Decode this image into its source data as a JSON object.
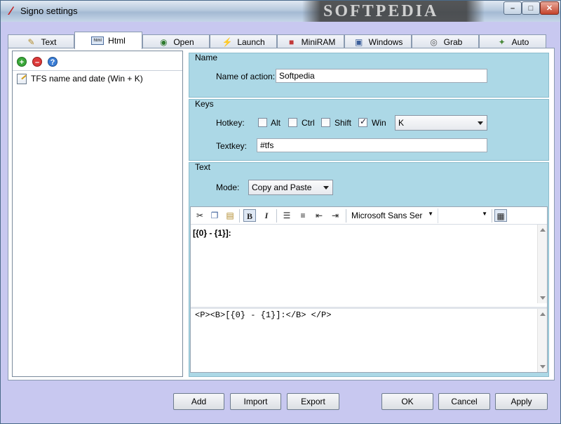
{
  "window": {
    "title": "Signo settings",
    "watermark": "SOFTPEDIA",
    "controls": {
      "minimize": "–",
      "maximize": "□",
      "close": "✕"
    }
  },
  "tabs": [
    {
      "label": "Text",
      "icon": "pencil-icon",
      "active": false
    },
    {
      "label": "Html",
      "icon": "html-icon",
      "active": true
    },
    {
      "label": "Open",
      "icon": "globe-icon",
      "active": false
    },
    {
      "label": "Launch",
      "icon": "lightning-icon",
      "active": false
    },
    {
      "label": "MiniRAM",
      "icon": "cube-icon",
      "active": false
    },
    {
      "label": "Windows",
      "icon": "monitor-icon",
      "active": false
    },
    {
      "label": "Grab",
      "icon": "camera-icon",
      "active": false
    },
    {
      "label": "Auto",
      "icon": "wand-icon",
      "active": false
    }
  ],
  "left_panel": {
    "toolbar": {
      "add": "+",
      "remove": "–",
      "help": "?"
    },
    "items": [
      {
        "label": "TFS name and date (Win + K)"
      }
    ]
  },
  "name_group": {
    "legend": "Name",
    "action_label": "Name of action:",
    "action_value": "Softpedia"
  },
  "keys_group": {
    "legend": "Keys",
    "hotkey_label": "Hotkey:",
    "modifiers": [
      {
        "label": "Alt",
        "checked": false
      },
      {
        "label": "Ctrl",
        "checked": false
      },
      {
        "label": "Shift",
        "checked": false
      },
      {
        "label": "Win",
        "checked": true
      }
    ],
    "key_value": "K",
    "textkey_label": "Textkey:",
    "textkey_value": "#tfs"
  },
  "text_group": {
    "legend": "Text",
    "mode_label": "Mode:",
    "mode_value": "Copy and Paste"
  },
  "editor": {
    "font_name": "Microsoft Sans Ser",
    "content": "[{0} - {1}]:",
    "source": "<P><B>[{0} - {1}]:</B> </P>"
  },
  "buttons": {
    "add": "Add",
    "import": "Import",
    "export": "Export",
    "ok": "OK",
    "cancel": "Cancel",
    "apply": "Apply"
  }
}
